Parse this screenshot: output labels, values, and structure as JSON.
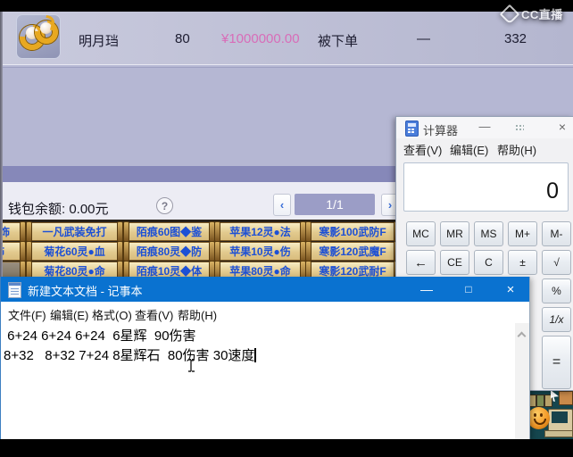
{
  "watermark": {
    "label": "CC直播"
  },
  "listing": {
    "name": "明月珰",
    "level": "80",
    "price": "¥1000000.00",
    "status": "被下单",
    "dash": "—",
    "count": "332"
  },
  "wallet": {
    "balance_label": "钱包余额: 0.00元",
    "help": "?",
    "prev": "‹",
    "page": "1/1",
    "next": "›"
  },
  "item_buttons": {
    "row1": {
      "partial": "灵饰",
      "b1": "一凡武装免打",
      "b2": "陌痕60图◆鉴",
      "b3": "苹果12灵●法",
      "b4": "寒影100武防F"
    },
    "row2": {
      "partial": "饰",
      "b1": "菊花60灵●血",
      "b2": "陌痕80灵◆防",
      "b3": "苹果10灵●伤",
      "b4": "寒影120武魔F"
    },
    "row3": {
      "partial": "",
      "b1": "菊花80灵●命",
      "b2": "陌痕10灵◆体",
      "b3": "苹果80灵●命",
      "b4": "寒影120武耐F"
    }
  },
  "calculator": {
    "title": "计算器",
    "minimize": "—",
    "close": "×",
    "menu": {
      "m1": "查看(V)",
      "m2": "编辑(E)",
      "m3": "帮助(H)"
    },
    "display": "0",
    "keys": {
      "mc": "MC",
      "mr": "MR",
      "ms": "MS",
      "mplus": "M+",
      "mminus": "M-",
      "back": "←",
      "ce": "CE",
      "c": "C",
      "pm": "±",
      "sqrt": "√",
      "pct": "%",
      "inv": "1/x",
      "eq": "="
    }
  },
  "notepad": {
    "title": "新建文本文档 - 记事本",
    "minimize": "—",
    "maximize": "□",
    "close": "×",
    "menu": {
      "m1": "文件(F)",
      "m2": "编辑(E)",
      "m3": "格式(O)",
      "m4": "查看(V)",
      "m5": "帮助(H)"
    },
    "line1": " 6+24 6+24 6+24  6星辉  90伤害",
    "line2": "8+32   8+32 7+24 8星辉石  80伤害 30速度"
  }
}
